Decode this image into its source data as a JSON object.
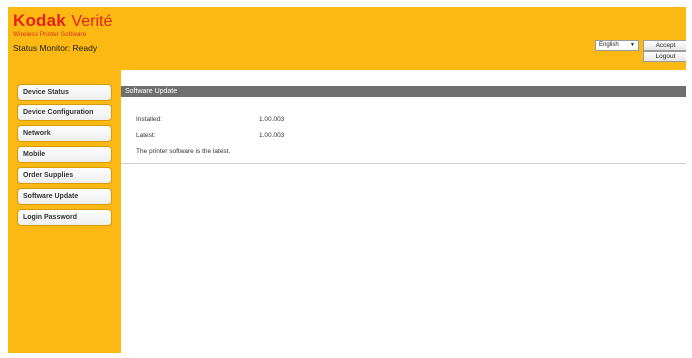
{
  "brand": {
    "kodak": "Kodak",
    "verite": "Verité",
    "subtitle": "Wireless Printer Software"
  },
  "status_monitor": "Status Monitor: Ready",
  "header": {
    "language": "English",
    "accept_label": "Accept",
    "logout_label": "Logout"
  },
  "sidebar": {
    "items": [
      {
        "label": "Device Status"
      },
      {
        "label": "Device Configuration"
      },
      {
        "label": "Network"
      },
      {
        "label": "Mobile"
      },
      {
        "label": "Order Supplies"
      },
      {
        "label": "Software Update"
      },
      {
        "label": "Login Password"
      }
    ]
  },
  "main": {
    "section_title": "Software Update",
    "installed_label": "Installed:",
    "installed_value": "1.00.003",
    "latest_label": "Latest:",
    "latest_value": "1.00.003",
    "message": "The printer software is the latest."
  },
  "colors": {
    "background": "#fdb913",
    "brand_red": "#e2231a",
    "section_header": "#6f6f6f"
  }
}
